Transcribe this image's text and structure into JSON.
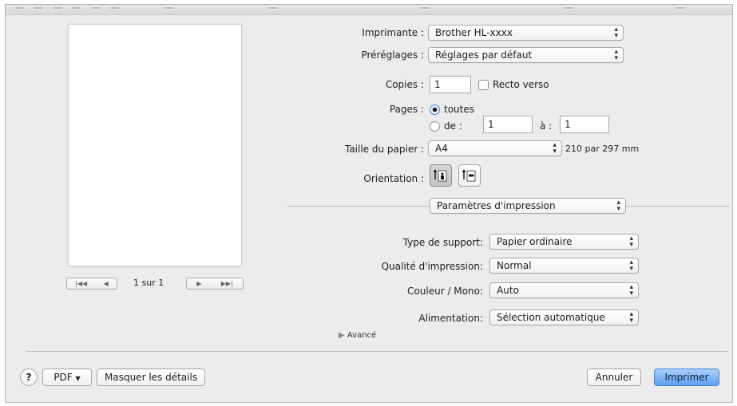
{
  "printer": {
    "label": "Imprimante :",
    "value": "Brother HL-xxxx"
  },
  "presets": {
    "label": "Préréglages :",
    "value": "Réglages par défaut"
  },
  "copies": {
    "label": "Copies :",
    "value": "1",
    "duplex_label": "Recto verso",
    "duplex_checked": false
  },
  "pages": {
    "label": "Pages :",
    "all_label": "toutes",
    "all_selected": true,
    "range_label": "de :",
    "from": "1",
    "to_label": "à :",
    "to": "1"
  },
  "paper": {
    "label": "Taille du papier :",
    "value": "A4",
    "dimensions": "210 par 297 mm"
  },
  "orientation": {
    "label": "Orientation :",
    "selected": "portrait"
  },
  "section_popup": {
    "value": "Paramètres d'impression"
  },
  "media_type": {
    "label": "Type de support:",
    "value": "Papier ordinaire"
  },
  "print_quality": {
    "label": "Qualité d'impression:",
    "value": "Normal"
  },
  "color_mono": {
    "label": "Couleur / Mono:",
    "value": "Auto"
  },
  "paper_source": {
    "label": "Alimentation:",
    "value": "Sélection automatique"
  },
  "advanced": {
    "label": "Avancé"
  },
  "preview_nav": {
    "page_text": "1 sur 1"
  },
  "footer": {
    "help_label": "?",
    "pdf_label": "PDF",
    "hide_details_label": "Masquer les détails",
    "cancel_label": "Annuler",
    "print_label": "Imprimer"
  },
  "colors": {
    "accent": "#5d9ff2",
    "dialog_bg": "#ececec"
  }
}
